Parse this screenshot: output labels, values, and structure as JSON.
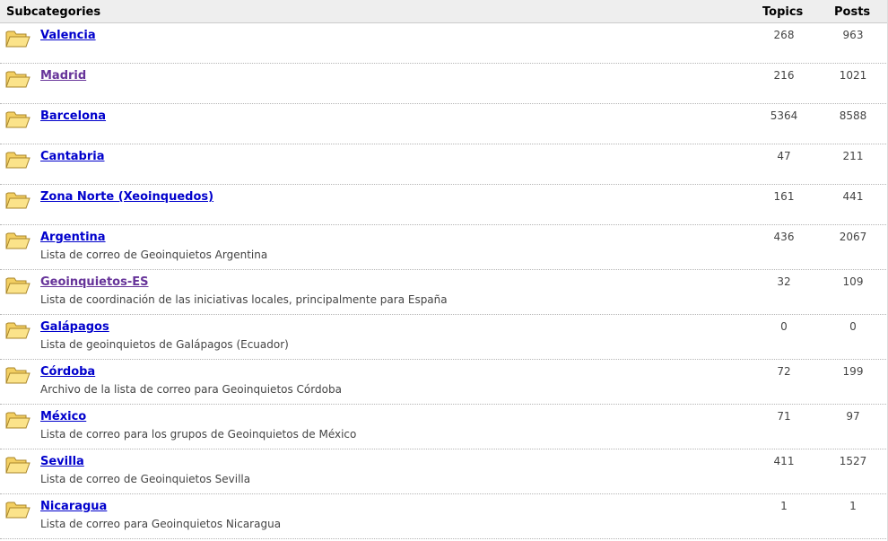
{
  "header": {
    "subcategories": "Subcategories",
    "topics": "Topics",
    "posts": "Posts"
  },
  "rows": [
    {
      "title": "Valencia",
      "desc": "",
      "topics": "268",
      "posts": "963",
      "visited": false
    },
    {
      "title": "Madrid",
      "desc": "",
      "topics": "216",
      "posts": "1021",
      "visited": true
    },
    {
      "title": "Barcelona",
      "desc": "",
      "topics": "5364",
      "posts": "8588",
      "visited": false
    },
    {
      "title": "Cantabria",
      "desc": "",
      "topics": "47",
      "posts": "211",
      "visited": false
    },
    {
      "title": "Zona Norte (Xeoinquedos)",
      "desc": "",
      "topics": "161",
      "posts": "441",
      "visited": false
    },
    {
      "title": "Argentina",
      "desc": "Lista de correo de Geoinquietos Argentina",
      "topics": "436",
      "posts": "2067",
      "visited": false
    },
    {
      "title": "Geoinquietos-ES",
      "desc": "Lista de coordinación de las iniciativas locales, principalmente para España",
      "topics": "32",
      "posts": "109",
      "visited": true
    },
    {
      "title": "Galápagos",
      "desc": "Lista de geoinquietos de Galápagos (Ecuador)",
      "topics": "0",
      "posts": "0",
      "visited": false
    },
    {
      "title": "Córdoba",
      "desc": "Archivo de la lista de correo para Geoinquietos Córdoba",
      "topics": "72",
      "posts": "199",
      "visited": false
    },
    {
      "title": "México",
      "desc": "Lista de correo para los grupos de Geoinquietos de México",
      "topics": "71",
      "posts": "97",
      "visited": false
    },
    {
      "title": "Sevilla",
      "desc": "Lista de correo de Geoinquietos Sevilla",
      "topics": "411",
      "posts": "1527",
      "visited": false
    },
    {
      "title": "Nicaragua",
      "desc": "Lista de correo para Geoinquietos Nicaragua",
      "topics": "1",
      "posts": "1",
      "visited": false
    }
  ],
  "icons": {
    "folder": "folder-icon"
  },
  "colors": {
    "link": "#0000cc",
    "visited": "#663399",
    "folder_fill": "#fbe38a",
    "folder_stroke": "#a8862a"
  }
}
